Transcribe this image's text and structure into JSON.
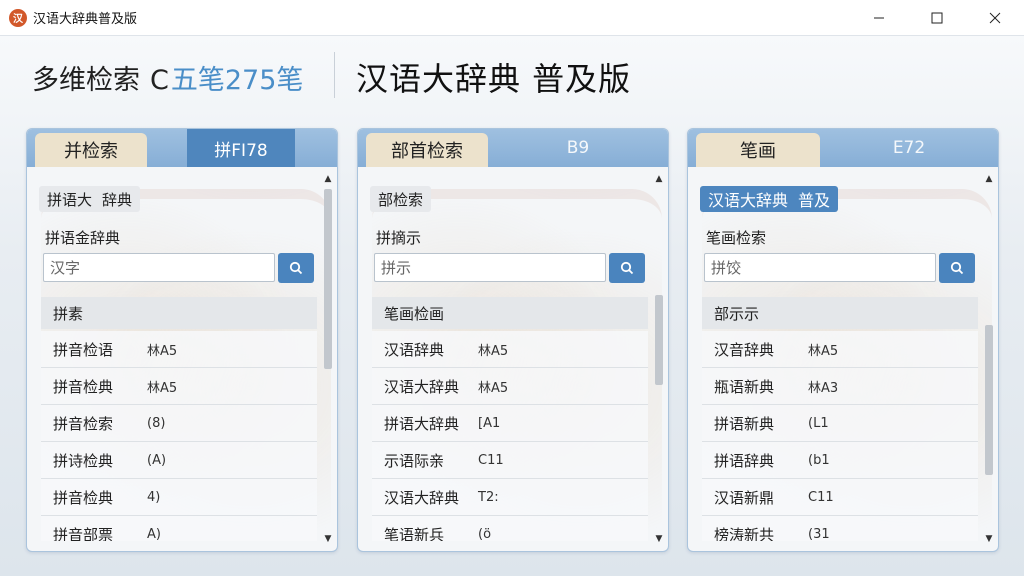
{
  "window": {
    "title": "汉语大辞典普及版",
    "app_icon": "app-logo-icon",
    "controls": [
      "minimize-icon",
      "maximize-icon",
      "close-icon"
    ]
  },
  "header": {
    "left_title": "多维检索",
    "left_letter": "C",
    "left_accent": "五笔275笔",
    "main_title": "汉语大辞典 普及版"
  },
  "panels": [
    {
      "tab_active": "并检索",
      "tab_inactive": "拼FI78",
      "chip_a": "拼语大",
      "chip_b": "辞典",
      "field_label": "拼语金辞典",
      "input_value": "汉字",
      "list_header": "拼素",
      "rows": [
        {
          "term": "拼音检语",
          "code": "林A5"
        },
        {
          "term": "拼音检典",
          "code": "林A5"
        },
        {
          "term": "拼音检索",
          "code": "(8)"
        },
        {
          "term": "拼诗检典",
          "code": "(A)"
        },
        {
          "term": "拼音检典",
          "code": "4)"
        },
        {
          "term": "拼音部票",
          "code": "A)"
        }
      ]
    },
    {
      "tab_active": "部首检索",
      "tab_inactive": "B9",
      "chip_a": "部检索",
      "chip_b": "",
      "field_label": "拼摘示",
      "input_value": "拼示",
      "list_header": "笔画检画",
      "rows": [
        {
          "term": "汉语辞典",
          "code": "林A5"
        },
        {
          "term": "汉语大辞典",
          "code": "林A5"
        },
        {
          "term": "拼语大辞典",
          "code": "[A1"
        },
        {
          "term": "示语际亲",
          "code": "C11"
        },
        {
          "term": "汉语大辞典",
          "code": "T2:"
        },
        {
          "term": "笔语新兵",
          "code": "(ö"
        }
      ]
    },
    {
      "tab_active": "笔画",
      "tab_inactive": "E72",
      "chip_a": "汉语大辞典",
      "chip_b": "普及",
      "field_label": "笔画检索",
      "input_value": "拼饺",
      "list_header": "部示示",
      "rows": [
        {
          "term": "汉音辞典",
          "code": "林A5"
        },
        {
          "term": "瓶语新典",
          "code": "林A3"
        },
        {
          "term": "拼语新典",
          "code": "(L1"
        },
        {
          "term": "拼语辞典",
          "code": "(b1"
        },
        {
          "term": "汉语新鼎",
          "code": "C11"
        },
        {
          "term": "榜涛新共",
          "code": "(31"
        }
      ]
    }
  ],
  "icons": {
    "search": "search-icon",
    "scroll_up": "chevron-up-icon",
    "scroll_down": "chevron-down-icon"
  },
  "colors": {
    "accent_blue": "#4a84be",
    "tab_beige": "#ece2cc",
    "tab_bar": "#86aed6"
  }
}
